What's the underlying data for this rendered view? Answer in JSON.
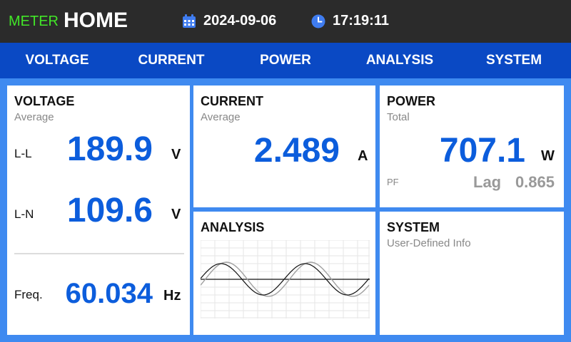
{
  "header": {
    "brand_prefix": "METER",
    "title": "HOME",
    "date": "2024-09-06",
    "time": "17:19:11",
    "icons": {
      "date": "calendar-icon",
      "time": "clock-icon"
    },
    "colors": {
      "brand_prefix": "#42e628",
      "bar": "#2b2b2b"
    }
  },
  "nav": {
    "tabs": [
      "VOLTAGE",
      "CURRENT",
      "POWER",
      "ANALYSIS",
      "SYSTEM"
    ],
    "bg": "#0a49c4"
  },
  "voltage": {
    "title": "VOLTAGE",
    "subtitle": "Average",
    "ll_label": "L-L",
    "ll_value": "189.9",
    "ll_unit": "V",
    "ln_label": "L-N",
    "ln_value": "109.6",
    "ln_unit": "V",
    "freq_label": "Freq.",
    "freq_value": "60.034",
    "freq_unit": "Hz"
  },
  "current": {
    "title": "CURRENT",
    "subtitle": "Average",
    "value": "2.489",
    "unit": "A"
  },
  "power": {
    "title": "POWER",
    "subtitle": "Total",
    "value": "707.1",
    "unit": "W",
    "pf_label": "PF",
    "pf_type": "Lag",
    "pf_value": "0.865"
  },
  "analysis": {
    "title": "ANALYSIS"
  },
  "system": {
    "title": "SYSTEM",
    "subtitle": "User-Defined Info"
  },
  "colors": {
    "value": "#0c5ddc",
    "background": "#3f8af0"
  }
}
